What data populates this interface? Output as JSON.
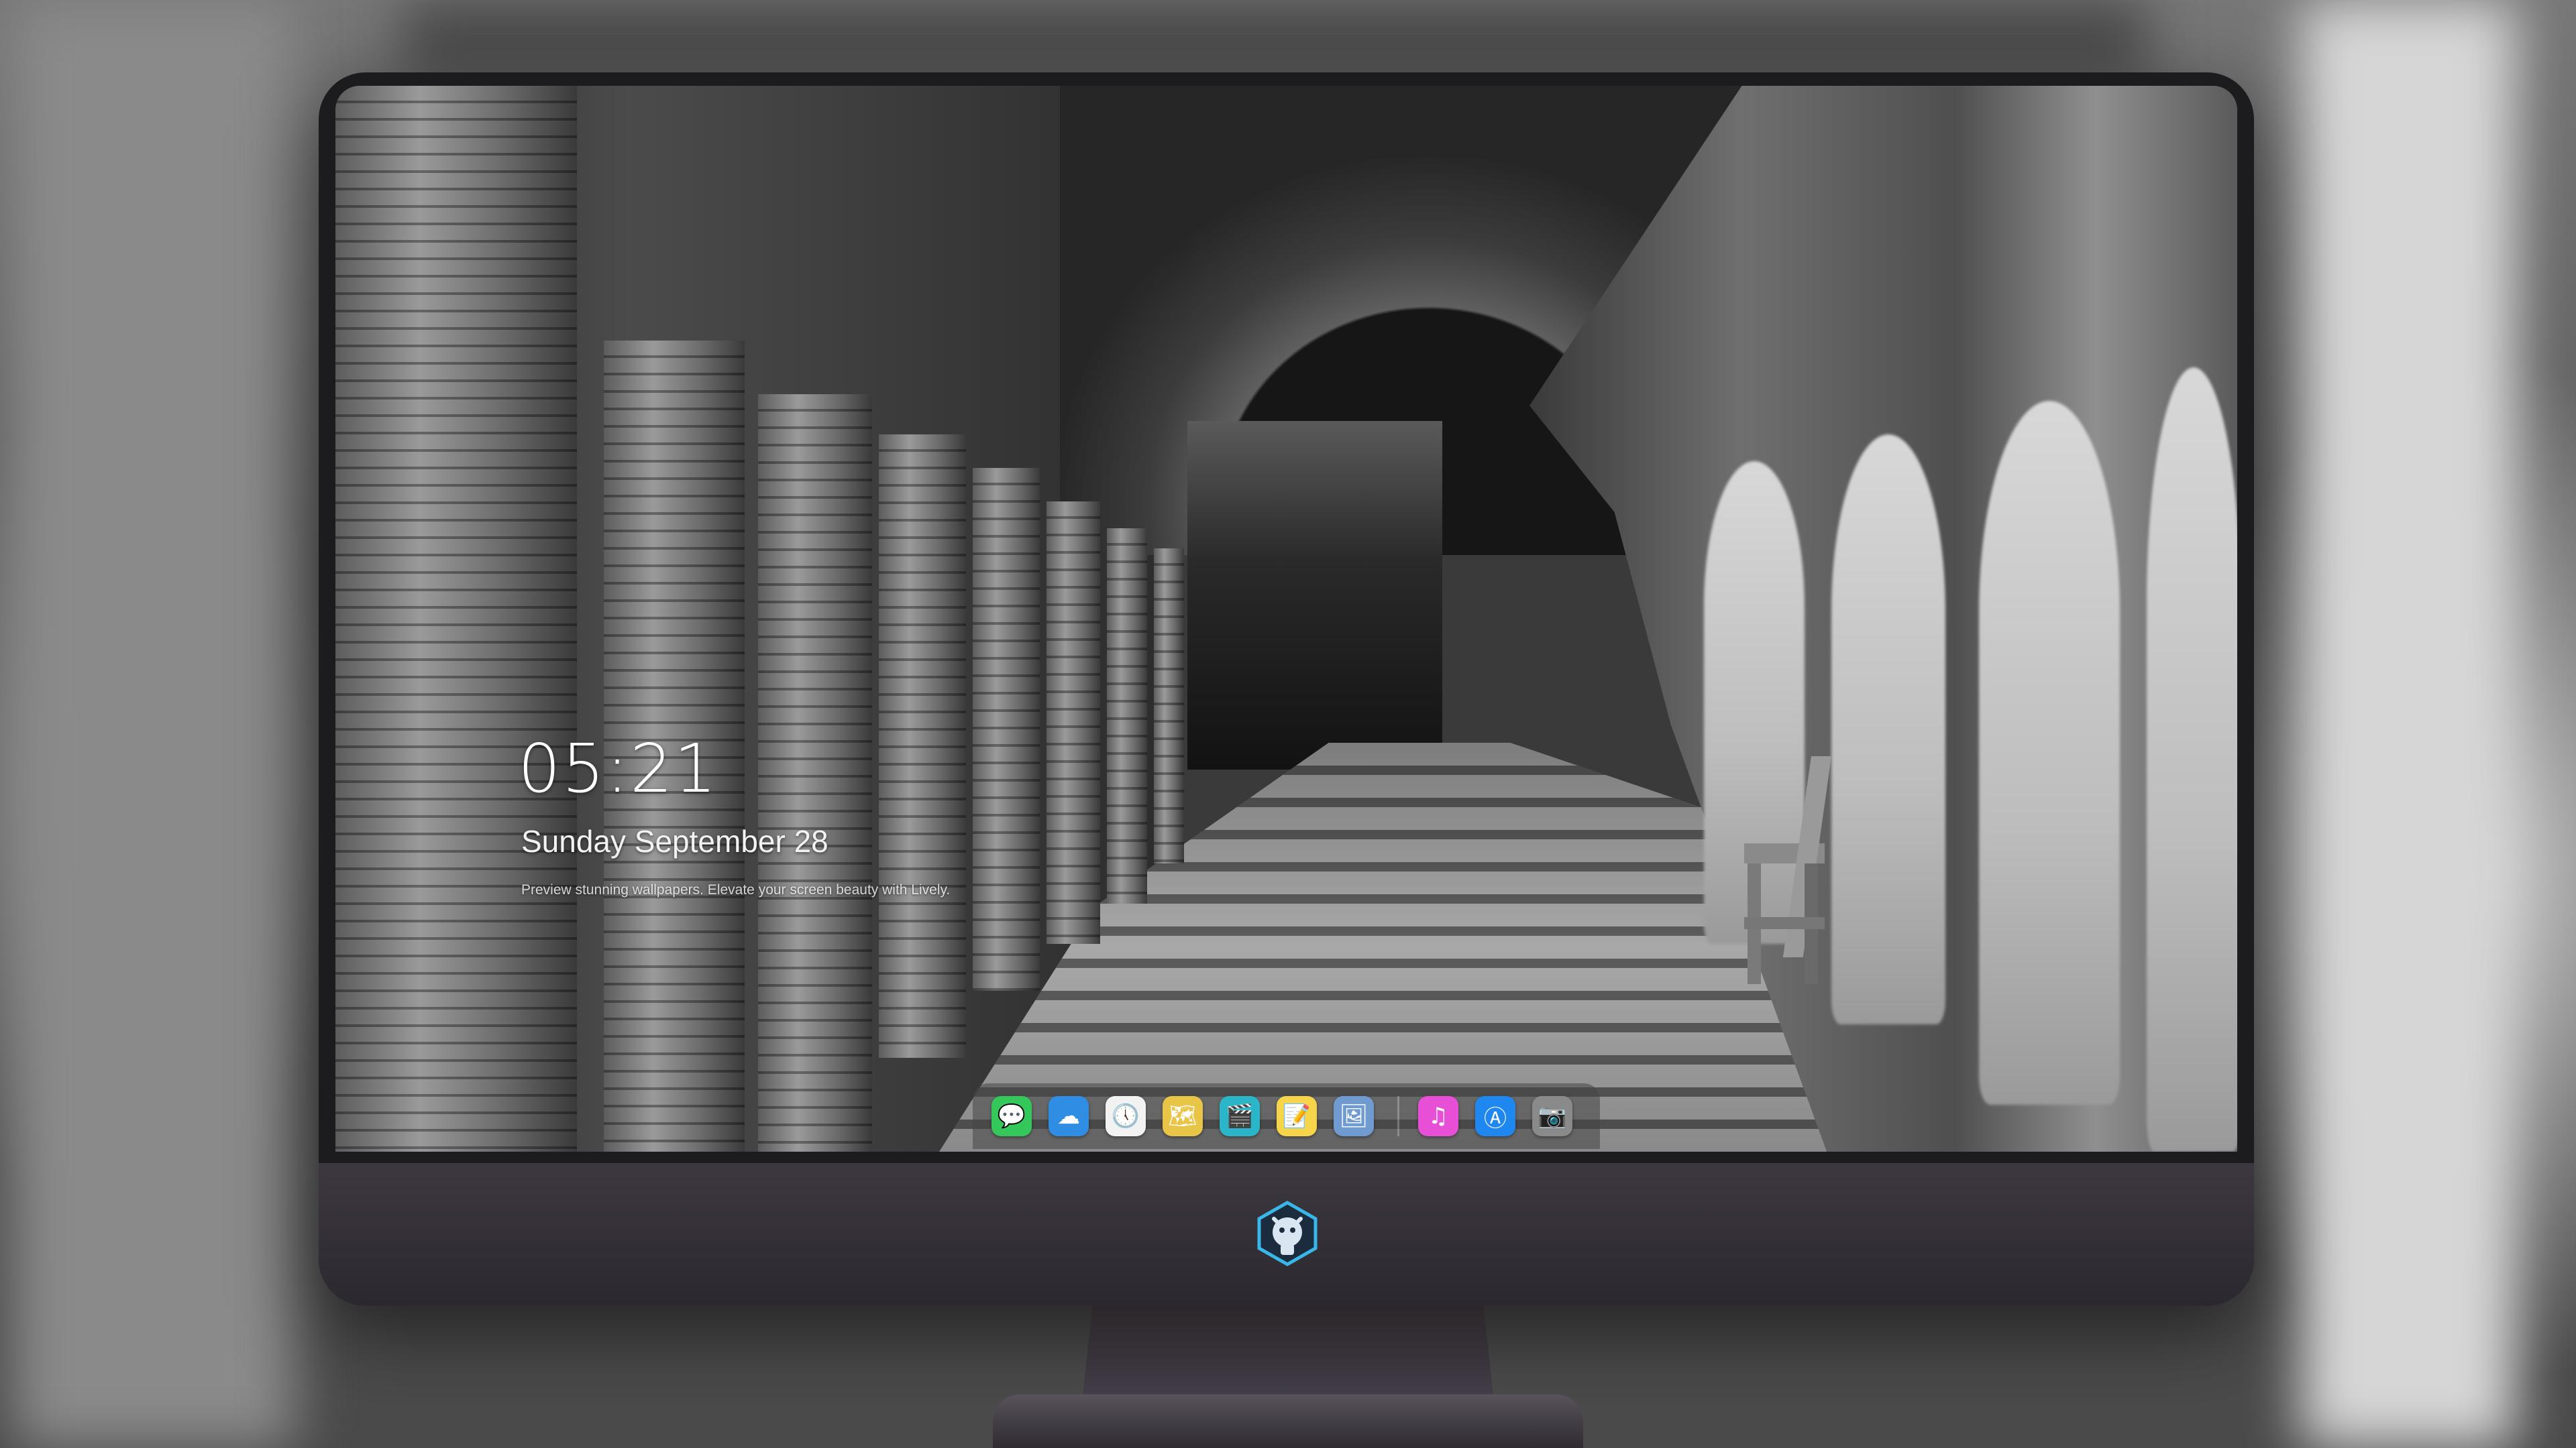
{
  "lock_screen": {
    "time": "05:21",
    "date": "Sunday September 28",
    "preview": "Preview stunning wallpapers. Elevate your screen beauty with Lively."
  },
  "dock": {
    "apps": [
      {
        "name": "messages",
        "icon": "message-bubble-icon",
        "glyph": "💬",
        "color": "#34c759"
      },
      {
        "name": "weather",
        "icon": "weather-cloud-icon",
        "glyph": "☁",
        "color": "#2f8de4"
      },
      {
        "name": "clock",
        "icon": "clock-icon",
        "glyph": "🕔",
        "color": "#f2f2f2"
      },
      {
        "name": "maps",
        "icon": "map-icon",
        "glyph": "🗺",
        "color": "#e8c547"
      },
      {
        "name": "videos",
        "icon": "clapperboard-icon",
        "glyph": "🎬",
        "color": "#2bb5c9"
      },
      {
        "name": "notes",
        "icon": "notes-icon",
        "glyph": "📝",
        "color": "#f7d54a"
      },
      {
        "name": "photos",
        "icon": "photos-icon",
        "glyph": "🖼",
        "color": "#6f9bd1"
      },
      {
        "name": "music",
        "icon": "music-note-icon",
        "glyph": "♫",
        "color": "#e64fd6"
      },
      {
        "name": "app-store",
        "icon": "app-store-icon",
        "glyph": "Ⓐ",
        "color": "#1e88f0"
      },
      {
        "name": "camera",
        "icon": "camera-icon",
        "glyph": "📷",
        "color": "#8a8a8a"
      }
    ]
  }
}
